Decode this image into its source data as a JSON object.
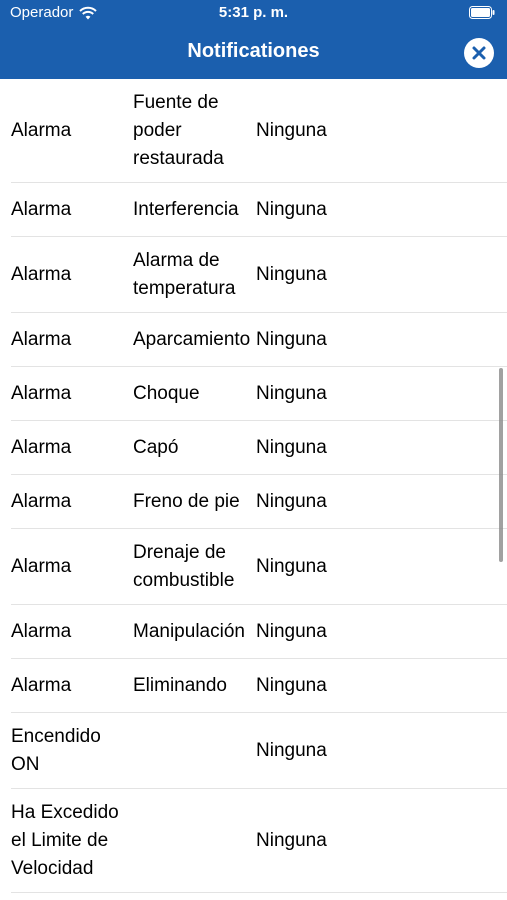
{
  "status_bar": {
    "carrier": "Operador",
    "time": "5:31 p. m.",
    "icons": [
      "wifi-icon",
      "battery-icon"
    ]
  },
  "header": {
    "title": "Notificationes",
    "close_icon": "close-icon"
  },
  "colors": {
    "header_bg": "#1b5fae",
    "text": "#000000",
    "divider": "#e3e3e3"
  },
  "rows": [
    {
      "type": "Alarma",
      "event": "Fuente de poder restaurada",
      "value": "Ninguna"
    },
    {
      "type": "Alarma",
      "event": "Interferencia",
      "value": "Ninguna"
    },
    {
      "type": "Alarma",
      "event": "Alarma de temperatura",
      "value": "Ninguna"
    },
    {
      "type": "Alarma",
      "event": "Aparcamiento",
      "value": "Ninguna"
    },
    {
      "type": "Alarma",
      "event": "Choque",
      "value": "Ninguna"
    },
    {
      "type": "Alarma",
      "event": "Capó",
      "value": "Ninguna"
    },
    {
      "type": "Alarma",
      "event": "Freno de pie",
      "value": "Ninguna"
    },
    {
      "type": "Alarma",
      "event": "Drenaje de combustible",
      "value": "Ninguna"
    },
    {
      "type": "Alarma",
      "event": "Manipulación",
      "value": "Ninguna"
    },
    {
      "type": "Alarma",
      "event": "Eliminando",
      "value": "Ninguna"
    },
    {
      "type": "Encendido ON",
      "event": "",
      "value": "Ninguna"
    },
    {
      "type": "Ha Excedido el Limite de Velocidad",
      "event": "",
      "value": "Ninguna"
    }
  ]
}
